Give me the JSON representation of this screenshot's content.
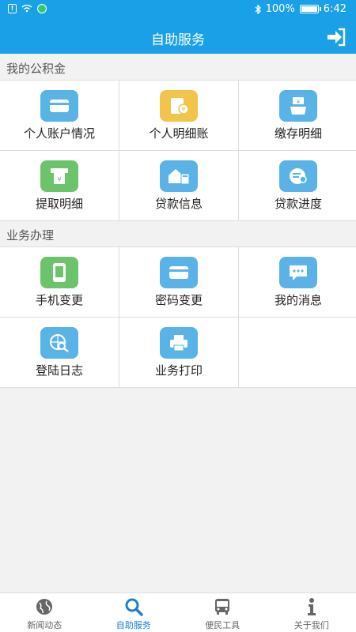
{
  "status": {
    "battery": "100%",
    "time": "6:42"
  },
  "title": "自助服务",
  "section1": {
    "label": "我的公积金",
    "items": [
      {
        "label": "个人账户情况",
        "icon": "wallet-icon",
        "color": "#5ab3e6"
      },
      {
        "label": "个人明细账",
        "icon": "ledger-icon",
        "color": "#f2c44c"
      },
      {
        "label": "缴存明细",
        "icon": "deposit-hand-icon",
        "color": "#5ab3e6"
      },
      {
        "label": "提取明细",
        "icon": "atm-withdraw-icon",
        "color": "#6cc46a"
      },
      {
        "label": "贷款信息",
        "icon": "house-calculator-icon",
        "color": "#5ab3e6"
      },
      {
        "label": "贷款进度",
        "icon": "progress-clock-icon",
        "color": "#5ab3e6"
      }
    ]
  },
  "section2": {
    "label": "业务办理",
    "items": [
      {
        "label": "手机变更",
        "icon": "phone-icon",
        "color": "#6cc46a"
      },
      {
        "label": "密码变更",
        "icon": "card-icon",
        "color": "#5ab3e6"
      },
      {
        "label": "我的消息",
        "icon": "message-icon",
        "color": "#5ab3e6"
      },
      {
        "label": "登陆日志",
        "icon": "globe-search-icon",
        "color": "#5ab3e6"
      },
      {
        "label": "业务打印",
        "icon": "printer-icon",
        "color": "#5ab3e6"
      }
    ]
  },
  "tabs": [
    {
      "label": "新闻动态",
      "icon": "globe-icon",
      "active": false
    },
    {
      "label": "自助服务",
      "icon": "search-icon",
      "active": true
    },
    {
      "label": "便民工具",
      "icon": "bus-icon",
      "active": false
    },
    {
      "label": "关于我们",
      "icon": "info-icon",
      "active": false
    }
  ]
}
